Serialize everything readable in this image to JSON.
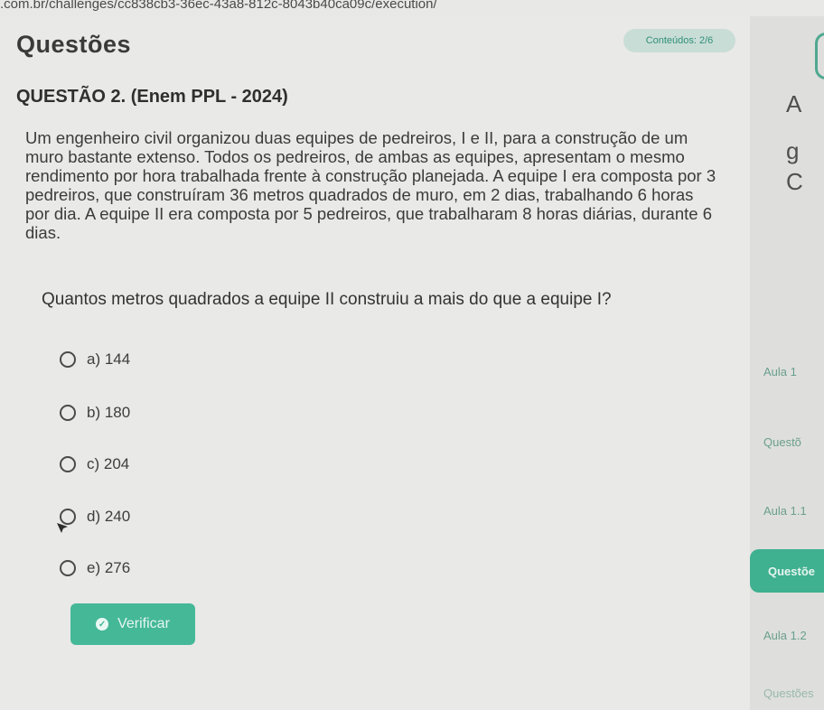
{
  "browser": {
    "url": ".com.br/challenges/cc838cb3-36ec-43a8-812c-8043b40ca09c/execution/"
  },
  "header": {
    "title": "Questões",
    "badge": "Conteúdos: 2/6"
  },
  "question": {
    "heading": "QUESTÃO 2. (Enem PPL - 2024)",
    "statement": "Um engenheiro civil organizou duas equipes de pedreiros, I e II, para a construção de um muro bastante extenso. Todos os pedreiros, de ambas as equipes, apresentam o mesmo rendimento por hora trabalhada frente à construção planejada. A equipe I era composta por 3 pedreiros, que construíram 36 metros quadrados de muro, em 2 dias, trabalhando 6 horas por dia. A equipe II era composta por 5 pedreiros, que trabalharam 8 horas diárias, durante 6 dias.",
    "prompt": "Quantos metros quadrados a equipe II construiu a mais do que a equipe I?",
    "options": [
      {
        "label": "a) 144"
      },
      {
        "label": "b) 180"
      },
      {
        "label": "c) 204"
      },
      {
        "label": "d) 240"
      },
      {
        "label": "e) 276"
      }
    ],
    "verify_label": "Verificar"
  },
  "sidebar": {
    "glyphs": [
      "A",
      "g",
      "C"
    ],
    "items": [
      {
        "label": "Aula 1"
      },
      {
        "label": "Questõ"
      },
      {
        "label": "Aula 1.1"
      },
      {
        "label": "Questõe"
      },
      {
        "label": "Aula 1.2"
      },
      {
        "label": "Questões"
      }
    ]
  },
  "colors": {
    "accent": "#45b898",
    "badge_bg": "#c9ddd7",
    "background": "#e9e9e7"
  },
  "icons": [
    "check-circle-icon",
    "mouse-cursor-icon",
    "radio-icon"
  ]
}
